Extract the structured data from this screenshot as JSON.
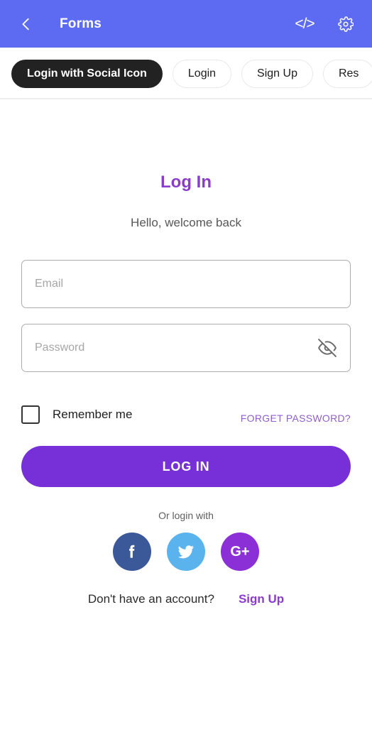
{
  "appbar": {
    "title": "Forms",
    "back_icon": "chevron-left-icon",
    "code_icon_label": "</>",
    "settings_icon": "gear-icon"
  },
  "tabs": [
    {
      "label": "Login with Social Icon",
      "active": true
    },
    {
      "label": "Login",
      "active": false
    },
    {
      "label": "Sign Up",
      "active": false
    },
    {
      "label": "Res",
      "active": false
    }
  ],
  "form": {
    "title": "Log In",
    "subtitle": "Hello, welcome back",
    "email": {
      "placeholder": "Email",
      "value": ""
    },
    "password": {
      "placeholder": "Password",
      "value": "",
      "toggle_icon": "eye-off-icon"
    },
    "remember_label": "Remember me",
    "remember_checked": false,
    "forget_password_label": "FORGET PASSWORD?",
    "submit_label": "LOG IN"
  },
  "social": {
    "divider_label": "Or login with",
    "buttons": [
      {
        "name": "facebook",
        "glyph": "f"
      },
      {
        "name": "twitter",
        "glyph": ""
      },
      {
        "name": "google-plus",
        "glyph": "G+"
      }
    ]
  },
  "footer": {
    "question": "Don't have an account?",
    "link_label": "Sign Up"
  },
  "colors": {
    "appbar": "#5c6bf2",
    "accent_purple": "#8b3ccc",
    "button_purple": "#7730d8",
    "link_purple": "#8f60c9",
    "tab_active_bg": "#222222",
    "facebook": "#3b5998",
    "twitter": "#5bb3ed",
    "google_plus": "#8b2fd6"
  }
}
